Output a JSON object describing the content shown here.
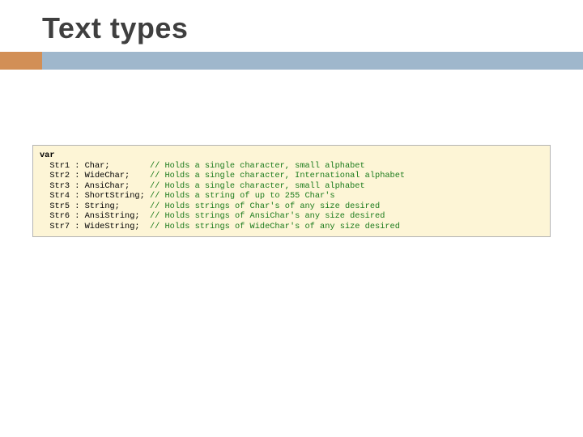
{
  "title": "Text types",
  "code": {
    "var_kw": "var",
    "lines": [
      {
        "decl": "  Str1 : Char;        ",
        "comment": "// Holds a single character, small alphabet"
      },
      {
        "decl": "  Str2 : WideChar;    ",
        "comment": "// Holds a single character, International alphabet"
      },
      {
        "decl": "  Str3 : AnsiChar;    ",
        "comment": "// Holds a single character, small alphabet"
      },
      {
        "decl": "  Str4 : ShortString; ",
        "comment": "// Holds a string of up to 255 Char's"
      },
      {
        "decl": "  Str5 : String;      ",
        "comment": "// Holds strings of Char's of any size desired"
      },
      {
        "decl": "  Str6 : AnsiString;  ",
        "comment": "// Holds strings of AnsiChar's any size desired"
      },
      {
        "decl": "  Str7 : WideString;  ",
        "comment": "// Holds strings of WideChar's of any size desired"
      }
    ]
  }
}
